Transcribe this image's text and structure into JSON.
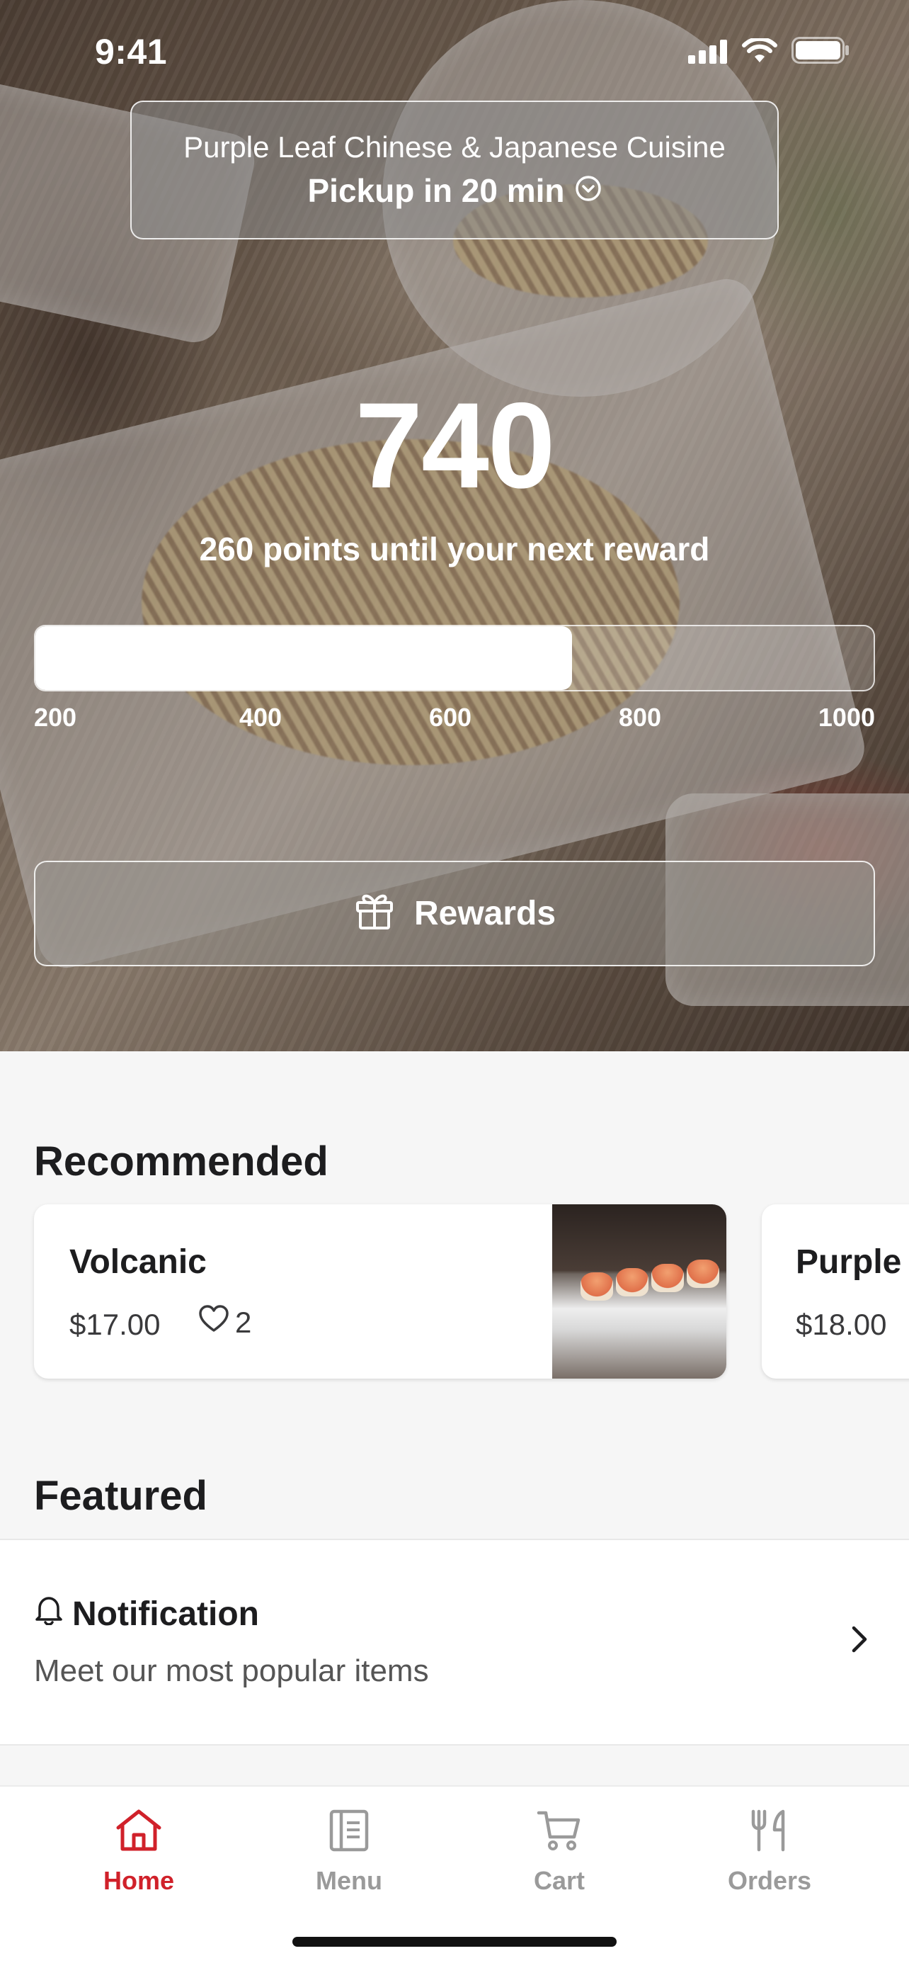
{
  "status_bar": {
    "time": "9:41"
  },
  "location": {
    "name": "Purple Leaf Chinese & Japanese Cuisine",
    "pickup": "Pickup in 20 min"
  },
  "points": {
    "value": "740",
    "subtitle": "260 points until your next reward",
    "progress_fraction": 0.64,
    "scale_labels": [
      "200",
      "400",
      "600",
      "800",
      "1000"
    ]
  },
  "rewards_button": {
    "label": "Rewards",
    "icon": "gift-icon"
  },
  "recommended": {
    "title": "Recommended",
    "items": [
      {
        "name": "Volcanic",
        "price": "$17.00",
        "likes": "2"
      },
      {
        "name": "Purple",
        "price": "$18.00"
      }
    ]
  },
  "featured": {
    "title": "Featured",
    "items": [
      {
        "title": "Notification",
        "subtitle": "Meet our most popular items",
        "icon": "bell-icon"
      }
    ]
  },
  "tabbar": {
    "tabs": [
      {
        "label": "Home",
        "icon": "home-icon",
        "active": true
      },
      {
        "label": "Menu",
        "icon": "menu-book-icon",
        "active": false
      },
      {
        "label": "Cart",
        "icon": "cart-icon",
        "active": false
      },
      {
        "label": "Orders",
        "icon": "fork-knife-icon",
        "active": false
      }
    ]
  },
  "colors": {
    "accent": "#d0212a",
    "inactive_tab": "#9a9a9a",
    "background": "#f6f6f6"
  }
}
